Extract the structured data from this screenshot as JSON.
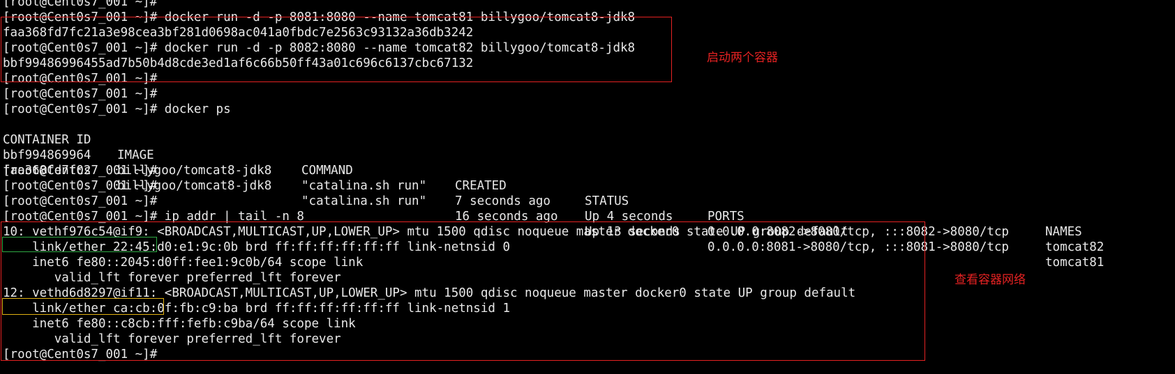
{
  "theme": {
    "background": "#000000",
    "foreground": "#e8e8e8",
    "annotation_red": "#e52222",
    "annotation_green": "#2eaa44",
    "annotation_yellow": "#e0b012"
  },
  "terminal": {
    "lines": [
      "[root@Cent0s7_001 ~]#",
      "[root@Cent0s7_001 ~]# docker run -d -p 8081:8080 --name tomcat81 billygoo/tomcat8-jdk8",
      "faa368fd7fc21a3e98cea3bf281d0698ac041a0fbdc7e2563c93132a36db3242",
      "[root@Cent0s7_001 ~]# docker run -d -p 8082:8080 --name tomcat82 billygoo/tomcat8-jdk8",
      "bbf99486996455ad7b50b4d8cde3ed1af6c66b50ff43a01c696c6137cbc67132",
      "[root@Cent0s7_001 ~]#",
      "[root@Cent0s7_001 ~]#",
      "[root@Cent0s7_001 ~]# docker ps"
    ],
    "docker_ps": {
      "headers": [
        "CONTAINER ID",
        "IMAGE",
        "COMMAND",
        "CREATED",
        "STATUS",
        "PORTS",
        "NAMES"
      ],
      "rows": [
        [
          "bbf994869964",
          "billygoo/tomcat8-jdk8",
          "\"catalina.sh run\"",
          "7 seconds ago",
          "Up 4 seconds",
          "0.0.0.0:8082->8080/tcp, :::8082->8080/tcp",
          "tomcat82"
        ],
        [
          "faa368fd7fc2",
          "billygoo/tomcat8-jdk8",
          "\"catalina.sh run\"",
          "16 seconds ago",
          "Up 13 seconds",
          "0.0.0.0:8081->8080/tcp, :::8081->8080/tcp",
          "tomcat81"
        ]
      ]
    },
    "lines_after": [
      "[root@Cent0s7_001 ~]#",
      "[root@Cent0s7_001 ~]#",
      "[root@Cent0s7_001 ~]#",
      "[root@Cent0s7_001 ~]# ip addr | tail -n 8",
      "10: vethf976c54@if9: <BROADCAST,MULTICAST,UP,LOWER_UP> mtu 1500 qdisc noqueue master docker0 state UP group default",
      "    link/ether 22:45:d0:e1:9c:0b brd ff:ff:ff:ff:ff:ff link-netnsid 0",
      "    inet6 fe80::2045:d0ff:fee1:9c0b/64 scope link",
      "       valid_lft forever preferred_lft forever",
      "12: vethd6d8297@if11: <BROADCAST,MULTICAST,UP,LOWER_UP> mtu 1500 qdisc noqueue master docker0 state UP group default",
      "    link/ether ca:cb:0f:fb:c9:ba brd ff:ff:ff:ff:ff:ff link-netnsid 1",
      "    inet6 fe80::c8cb:fff:fefb:c9ba/64 scope link",
      "       valid_lft forever preferred_lft forever",
      "[root@Cent0s7_001 ~]#"
    ]
  },
  "annotations": {
    "start_containers_label": "启动两个容器",
    "inspect_network_label": "查看容器网络"
  }
}
